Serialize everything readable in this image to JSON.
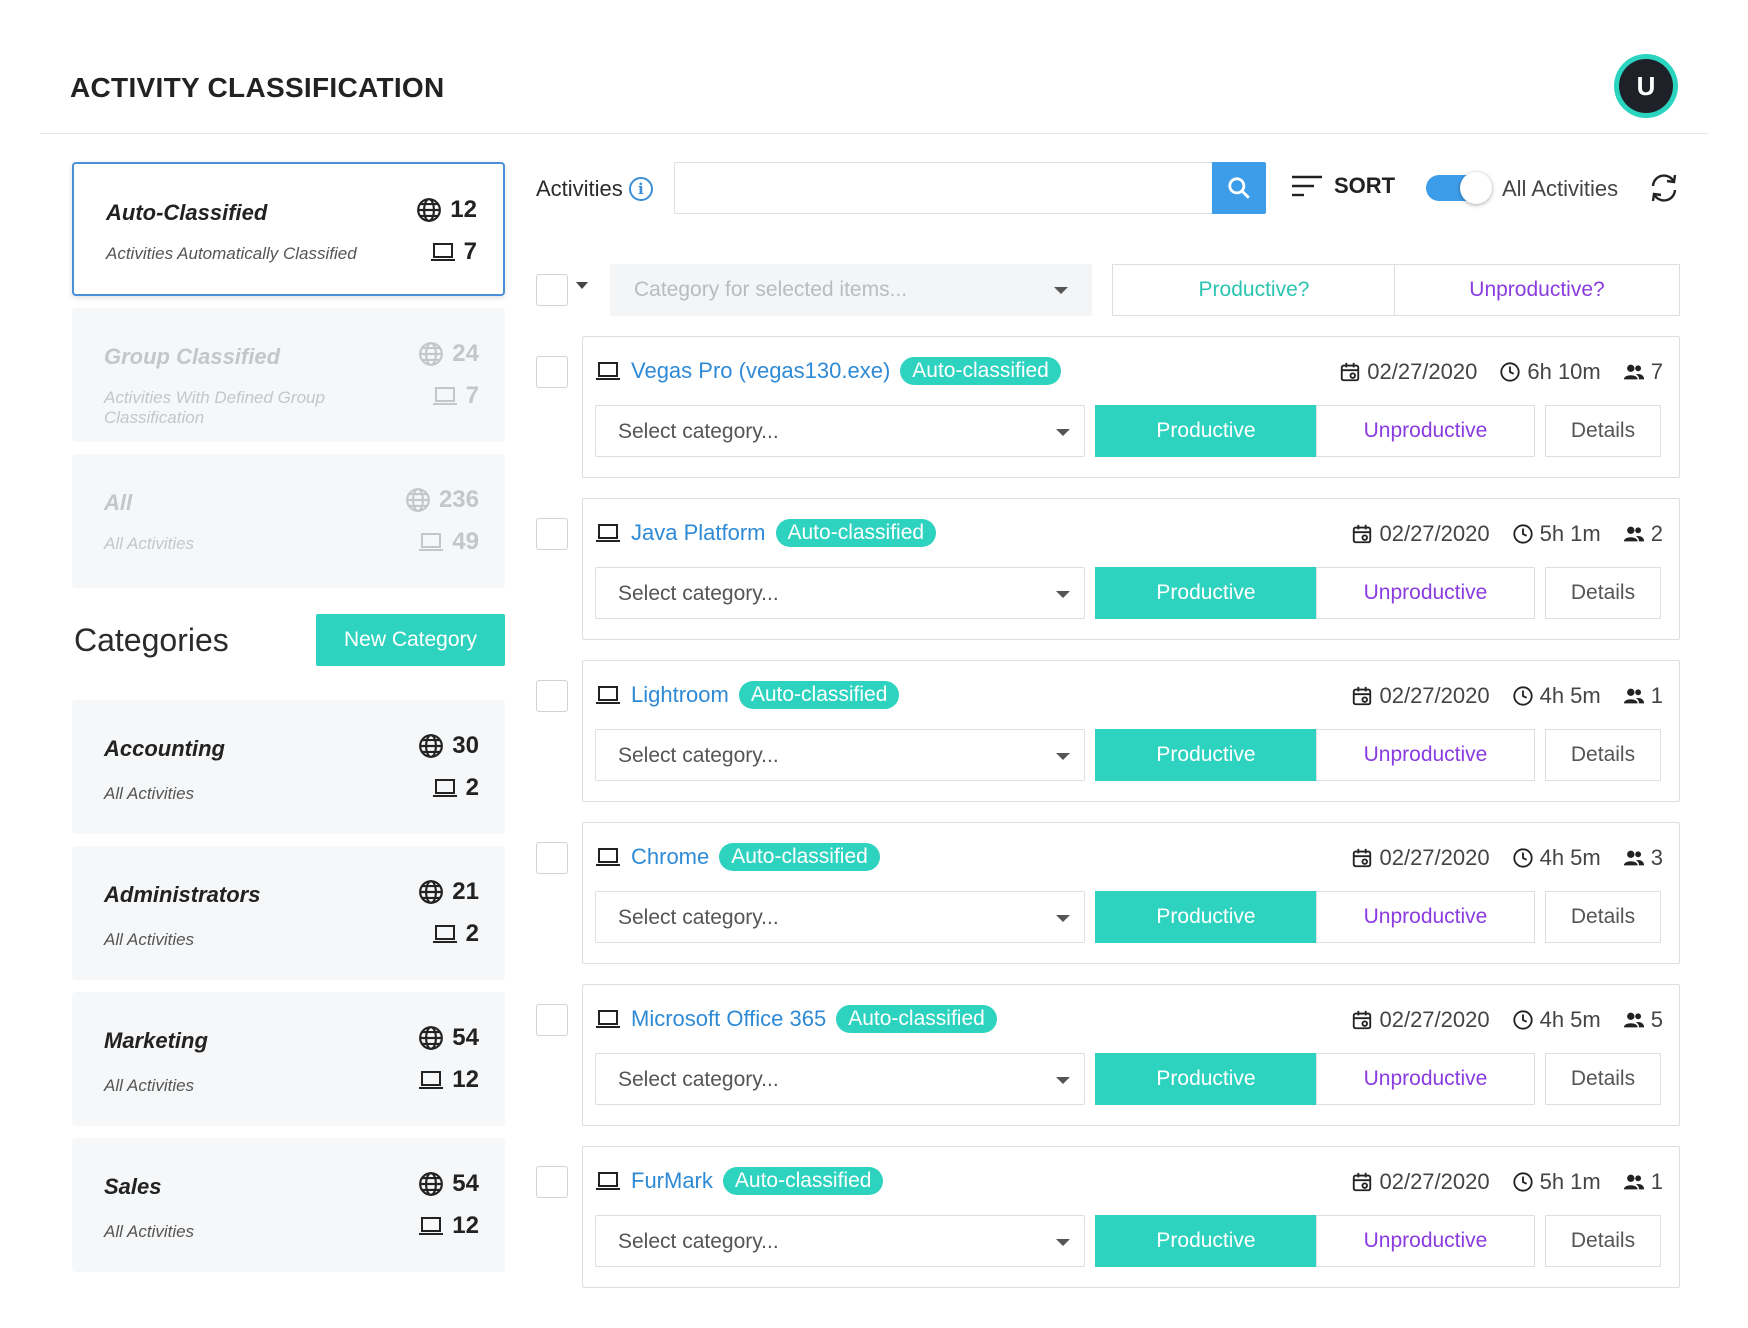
{
  "header": {
    "title": "ACTIVITY CLASSIFICATION",
    "avatar_initial": "U"
  },
  "classifications": [
    {
      "title": "Auto-Classified",
      "subtitle": "Activities Automatically Classified",
      "web_count": "12",
      "app_count": "7",
      "active": true
    },
    {
      "title": "Group Classified",
      "subtitle": "Activities With Defined Group Classification",
      "web_count": "24",
      "app_count": "7",
      "active": false
    },
    {
      "title": "All",
      "subtitle": "All Activities",
      "web_count": "236",
      "app_count": "49",
      "active": false
    }
  ],
  "categories_section": {
    "title": "Categories",
    "new_button": "New Category"
  },
  "categories": [
    {
      "title": "Accounting",
      "subtitle": "All Activities",
      "web_count": "30",
      "app_count": "2"
    },
    {
      "title": "Administrators",
      "subtitle": "All Activities",
      "web_count": "21",
      "app_count": "2"
    },
    {
      "title": "Marketing",
      "subtitle": "All Activities",
      "web_count": "54",
      "app_count": "12"
    },
    {
      "title": "Sales",
      "subtitle": "All Activities",
      "web_count": "54",
      "app_count": "12"
    }
  ],
  "toolbar": {
    "activities_label": "Activities",
    "info_glyph": "i",
    "search_value": "",
    "search_placeholder": "",
    "sort_label": "SORT",
    "toggle_label": "All Activities",
    "toggle_on": true
  },
  "bulk": {
    "placeholder": "Category for selected items...",
    "productive": "Productive?",
    "unproductive": "Unproductive?"
  },
  "activity_labels": {
    "badge": "Auto-classified",
    "select_placeholder": "Select category...",
    "productive": "Productive",
    "unproductive": "Unproductive",
    "details": "Details"
  },
  "activities": [
    {
      "name": "Vegas Pro (vegas130.exe)",
      "date": "02/27/2020",
      "duration": "6h 10m",
      "users": "7"
    },
    {
      "name": "Java Platform",
      "date": "02/27/2020",
      "duration": "5h 1m",
      "users": "2"
    },
    {
      "name": "Lightroom",
      "date": "02/27/2020",
      "duration": "4h 5m",
      "users": "1"
    },
    {
      "name": "Chrome",
      "date": "02/27/2020",
      "duration": "4h 5m",
      "users": "3"
    },
    {
      "name": "Microsoft Office 365",
      "date": "02/27/2020",
      "duration": "4h 5m",
      "users": "5"
    },
    {
      "name": "FurMark",
      "date": "02/27/2020",
      "duration": "5h 1m",
      "users": "1"
    }
  ],
  "colors": {
    "accent_teal": "#2ed3bf",
    "accent_blue": "#3d9de9",
    "link_blue": "#2f8ad6",
    "unproductive_purple": "#8a3ce0"
  }
}
